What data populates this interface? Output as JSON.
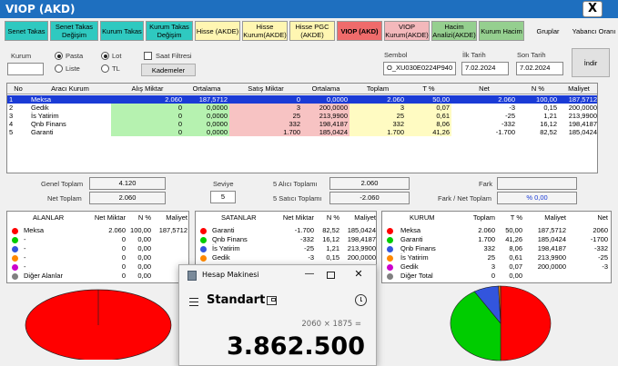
{
  "window": {
    "title": "VIOP (AKD)",
    "close_glyph": "X"
  },
  "tabs": [
    "Senet Takas",
    "Senet Takas Değişim",
    "Kurum Takas",
    "Kurum Takas Değişim",
    "Hisse (AKDE)",
    "Hisse Kurum(AKDE)",
    "Hisse PGC (AKDE)",
    "VIOP (AKD)",
    "VIOP Kurum(AKDE)",
    "Hacim Analizi(AKDE)",
    "Kurum Hacim",
    "Gruplar",
    "Yabancı Oranı"
  ],
  "filters": {
    "kurum_label": "Kurum",
    "kurum_value": "",
    "pasta": "Pasta",
    "liste": "Liste",
    "lot": "Lot",
    "tl": "TL",
    "saat_filtresi": "Saat Filtresi",
    "kademeler": "Kademeler",
    "sembol_label": "Sembol",
    "sembol_value": "O_XU030E0224P940",
    "ilk_tarih_label": "İlk Tarih",
    "ilk_tarih_value": "7.02.2024",
    "son_tarih_label": "Son Tarih",
    "son_tarih_value": "7.02.2024",
    "indir": "İndir"
  },
  "grid": {
    "columns": [
      "No",
      "Aracı Kurum",
      "Alış Miktar",
      "Ortalama",
      "Satış Miktar",
      "Ortalama",
      "Toplam",
      "T %",
      "Net",
      "N %",
      "Maliyet"
    ],
    "rows": [
      [
        "1",
        "Meksa",
        "2.060",
        "187,5712",
        "0",
        "0,0000",
        "2.060",
        "50,00",
        "2.060",
        "100,00",
        "187,5712"
      ],
      [
        "2",
        "Gedik",
        "0",
        "0,0000",
        "3",
        "200,0000",
        "3",
        "0,07",
        "-3",
        "0,15",
        "200,0000"
      ],
      [
        "3",
        "İs Yatirim",
        "0",
        "0,0000",
        "25",
        "213,9900",
        "25",
        "0,61",
        "-25",
        "1,21",
        "213,9900"
      ],
      [
        "4",
        "Qnb Finans",
        "0",
        "0,0000",
        "332",
        "198,4187",
        "332",
        "8,06",
        "-332",
        "16,12",
        "198,4187"
      ],
      [
        "5",
        "Garanti",
        "0",
        "0,0000",
        "1.700",
        "185,0424",
        "1.700",
        "41,26",
        "-1.700",
        "82,52",
        "185,0424"
      ]
    ]
  },
  "summary": {
    "genel_toplam_label": "Genel Toplam",
    "genel_toplam": "4.120",
    "net_toplam_label": "Net Toplam",
    "net_toplam": "2.060",
    "seviye_label": "Seviye",
    "seviye": "5",
    "alici_label": "5  Alıcı Toplamı",
    "alici": "2.060",
    "satici_label": "5  Satıcı Toplamı",
    "satici": "-2.060",
    "fark_label": "Fark",
    "fark": "",
    "fark_net_label": "Fark / Net Toplam",
    "fark_net": "% 0,00"
  },
  "alanlar": {
    "columns": [
      "ALANLAR",
      "Net Miktar",
      "N %",
      "Maliyet"
    ],
    "rows": [
      {
        "color": "#ff0000",
        "name": "Meksa",
        "net": "2.060",
        "pct": "100,00",
        "cost": "187,5712"
      },
      {
        "color": "#00cc00",
        "name": "-",
        "net": "0",
        "pct": "0,00",
        "cost": ""
      },
      {
        "color": "#3355dd",
        "name": "-",
        "net": "0",
        "pct": "0,00",
        "cost": ""
      },
      {
        "color": "#ff8800",
        "name": "-",
        "net": "0",
        "pct": "0,00",
        "cost": ""
      },
      {
        "color": "#cc00cc",
        "name": "-",
        "net": "0",
        "pct": "0,00",
        "cost": ""
      },
      {
        "color": "#808080",
        "name": "Diğer Alanlar",
        "net": "0",
        "pct": "0,00",
        "cost": ""
      }
    ]
  },
  "satanlar": {
    "columns": [
      "SATANLAR",
      "Net Miktar",
      "N %",
      "Maliyet"
    ],
    "rows": [
      {
        "color": "#ff0000",
        "name": "Garanti",
        "net": "-1.700",
        "pct": "82,52",
        "cost": "185,0424"
      },
      {
        "color": "#00cc00",
        "name": "Qnb Finans",
        "net": "-332",
        "pct": "16,12",
        "cost": "198,4187"
      },
      {
        "color": "#3355dd",
        "name": "İs Yatirim",
        "net": "-25",
        "pct": "1,21",
        "cost": "213,9900"
      },
      {
        "color": "#ff8800",
        "name": "Gedik",
        "net": "-3",
        "pct": "0,15",
        "cost": "200,0000"
      }
    ]
  },
  "kurum": {
    "columns": [
      "KURUM",
      "Toplam",
      "T %",
      "Maliyet",
      "Net"
    ],
    "rows": [
      {
        "color": "#ff0000",
        "name": "Meksa",
        "tot": "2.060",
        "pct": "50,00",
        "cost": "187,5712",
        "net": "2060"
      },
      {
        "color": "#00cc00",
        "name": "Garanti",
        "tot": "1.700",
        "pct": "41,26",
        "cost": "185,0424",
        "net": "-1700"
      },
      {
        "color": "#3355dd",
        "name": "Qnb Finans",
        "tot": "332",
        "pct": "8,06",
        "cost": "198,4187",
        "net": "-332"
      },
      {
        "color": "#ff8800",
        "name": "İs Yatirim",
        "tot": "25",
        "pct": "0,61",
        "cost": "213,9900",
        "net": "-25"
      },
      {
        "color": "#cc00cc",
        "name": "Gedik",
        "tot": "3",
        "pct": "0,07",
        "cost": "200,0000",
        "net": "-3"
      },
      {
        "color": "#808080",
        "name": "Diğer Total",
        "tot": "0",
        "pct": "0,00",
        "cost": "",
        "net": ""
      }
    ]
  },
  "pies": {
    "alanlar": [
      100
    ],
    "kurum": [
      50.0,
      41.26,
      8.06,
      0.61,
      0.07
    ]
  },
  "calculator": {
    "title": "Hesap Makinesi",
    "mode": "Standart",
    "expression": "2060 × 1875 =",
    "result": "3.862.500"
  }
}
